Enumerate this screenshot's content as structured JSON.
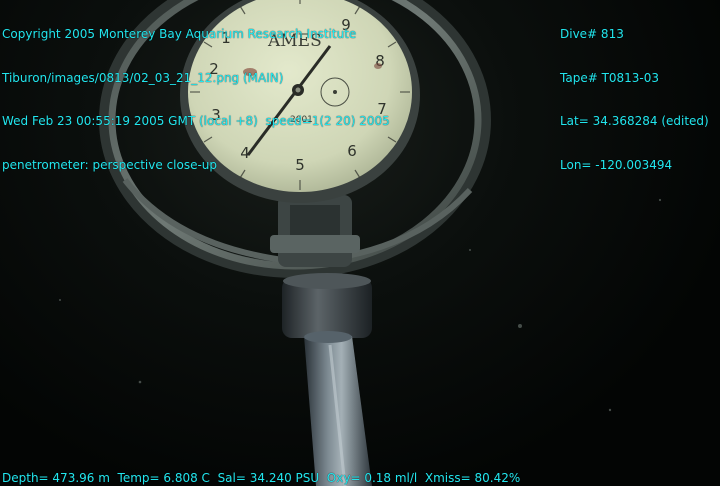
{
  "overlay": {
    "header_left": [
      "Copyright 2005 Monterey Bay Aquarium Research Institute",
      "Tiburon/images/0813/02_03_21_12.png (MAIN)",
      "Wed Feb 23 00:55:19 2005 GMT (local +8)  speed=1(2 20) 2005",
      "penetrometer: perspective close-up"
    ],
    "header_right": [
      "Dive# 813",
      "Tape# T0813-03",
      "Lat= 34.368284 (edited)",
      "Lon= -120.003494"
    ],
    "footer": "Depth= 473.96 m  Temp= 6.808 C  Sal= 34.240 PSU  Oxy= 0.18 ml/l  Xmiss= 80.42%"
  },
  "gauge": {
    "brand": "AMES",
    "model": "2001",
    "dial_numbers": [
      "1",
      "2",
      "3",
      "4",
      "5",
      "6",
      "7",
      "8",
      "9"
    ],
    "colors": {
      "overlay_text": "#22e6ee",
      "dial_face": "#d9dfc2",
      "background": "#050807"
    }
  }
}
